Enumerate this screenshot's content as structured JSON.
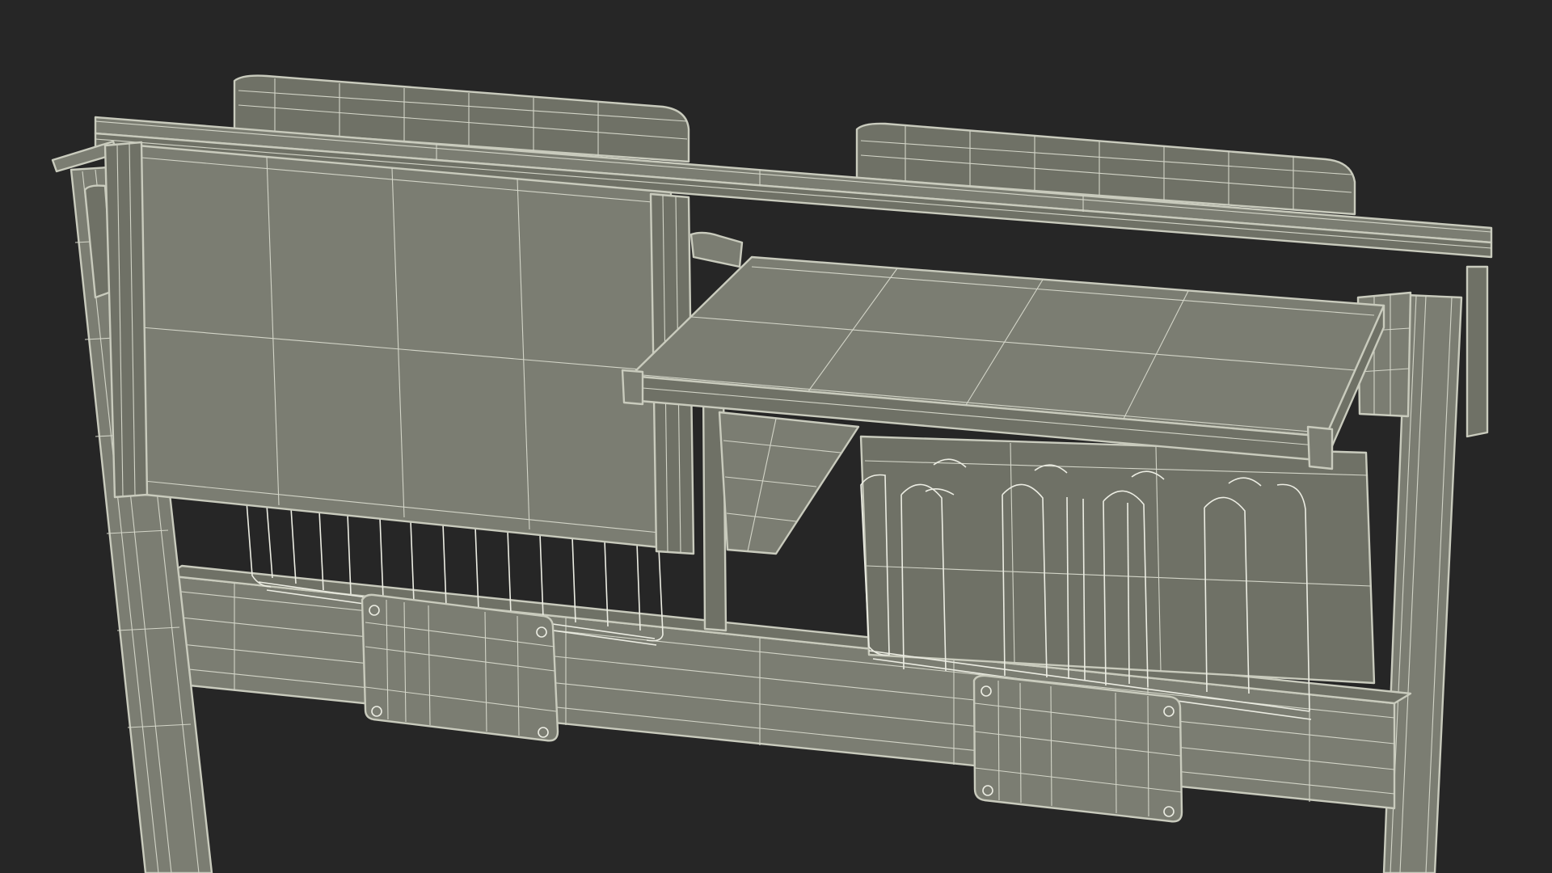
{
  "scene": {
    "subject": "",
    "background_color": "#262626",
    "surface_color": "#7b7d72",
    "surface_dark_color": "#6f7166",
    "wire_color": "#d3d5c8"
  }
}
